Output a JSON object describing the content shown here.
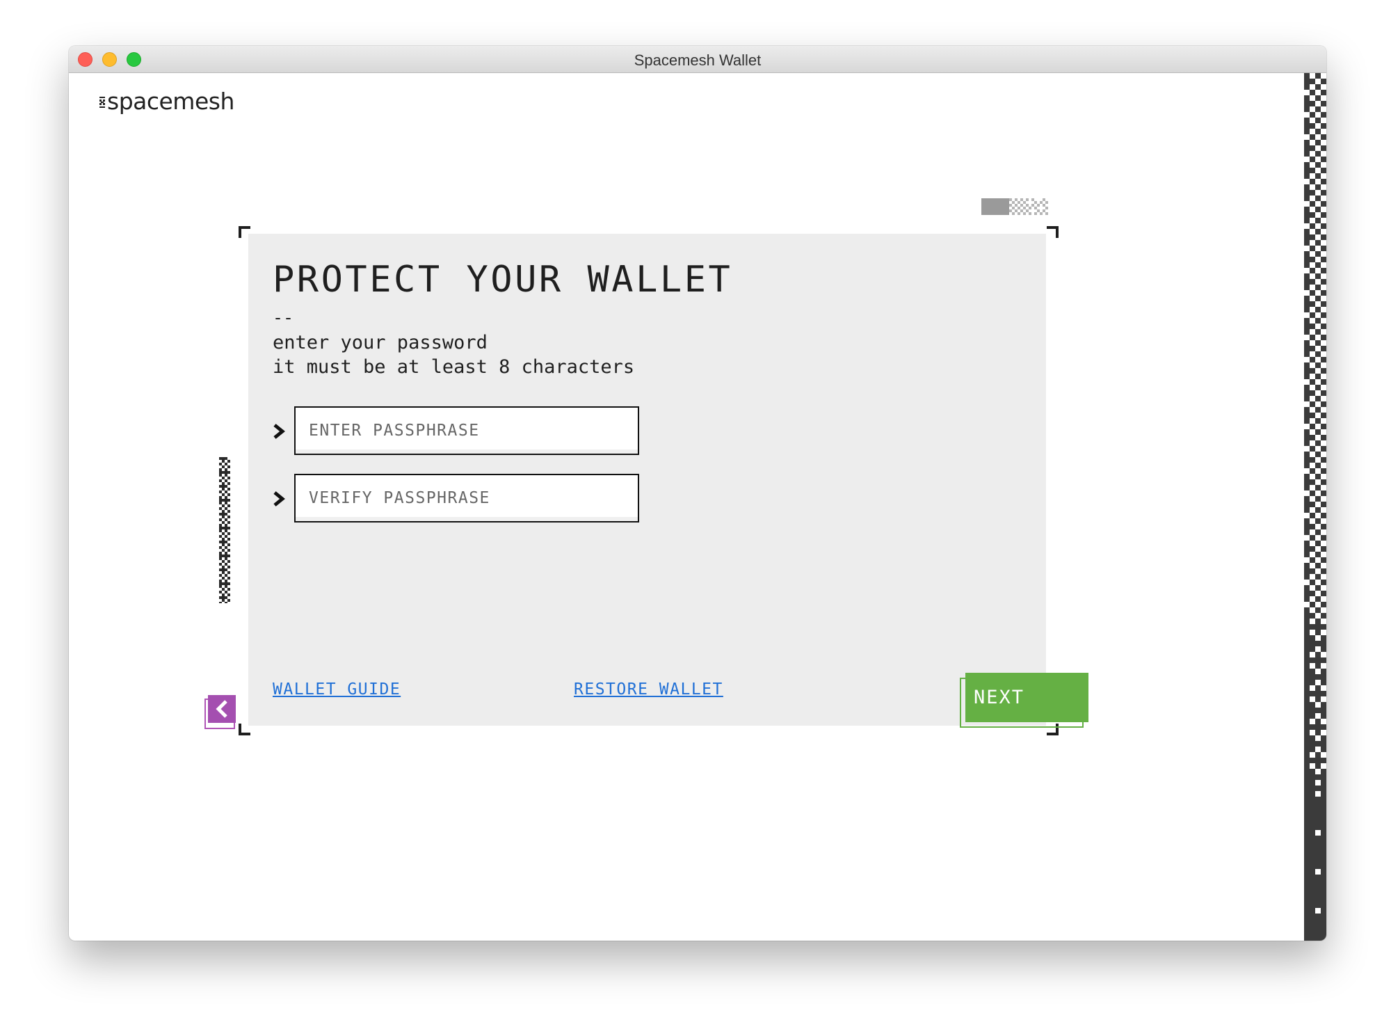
{
  "window": {
    "title": "Spacemesh Wallet"
  },
  "brand": {
    "logo_text": "spacemesh"
  },
  "card": {
    "title": "PROTECT YOUR WALLET",
    "separator": "--",
    "subtitle_line1": "enter your password",
    "subtitle_line2": "it must be at least 8 characters"
  },
  "form": {
    "passphrase": {
      "placeholder": "ENTER PASSPHRASE",
      "value": ""
    },
    "verify": {
      "placeholder": "VERIFY PASSPHRASE",
      "value": ""
    }
  },
  "links": {
    "wallet_guide": "WALLET GUIDE",
    "restore_wallet": "RESTORE WALLET"
  },
  "buttons": {
    "next": "NEXT",
    "back_icon": "chevron-left-icon"
  },
  "colors": {
    "accent_green": "#65b044",
    "accent_purple": "#a44fb0",
    "link_blue": "#1f6fd6",
    "panel_bg": "#ededed",
    "pattern_dark": "#3b3b3b"
  }
}
